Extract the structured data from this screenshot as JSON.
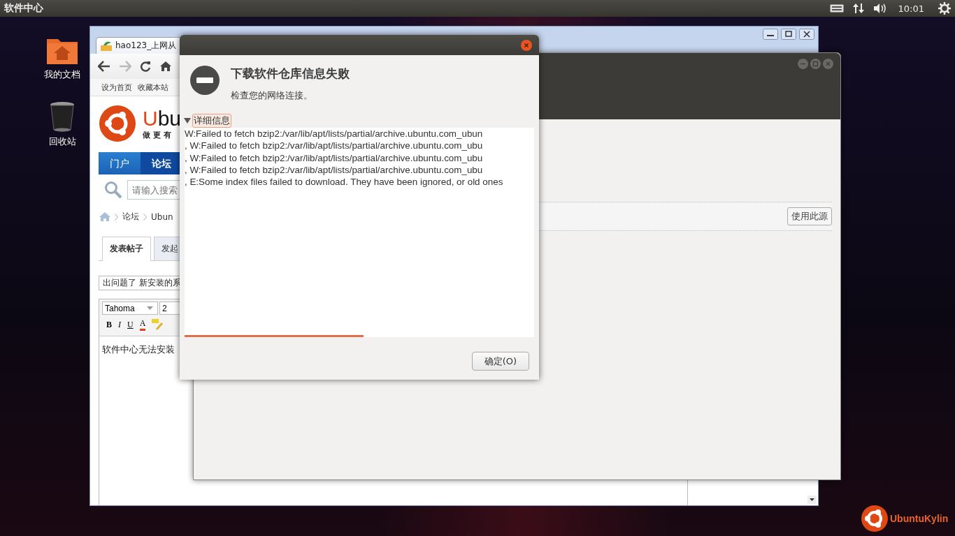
{
  "top_panel": {
    "app_name": "软件中心",
    "clock": "10:01"
  },
  "desktop_icons": [
    {
      "label": "我的文档",
      "kind": "folder"
    },
    {
      "label": "回收站",
      "kind": "trash"
    }
  ],
  "browser": {
    "tab_title": "hao123_上网从",
    "bookmarks": [
      "设为首页",
      "收藏本站"
    ],
    "logo_accent": "U",
    "logo_rest": "bu",
    "slogan": "做 更 有",
    "nav": [
      {
        "label": "门户",
        "selected": false
      },
      {
        "label": "论坛",
        "selected": true
      }
    ],
    "search_placeholder": "请输入搜索",
    "breadcrumb": [
      "论坛",
      "Ubun"
    ],
    "post_tabs": [
      {
        "label": "发表帖子",
        "selected": true
      },
      {
        "label": "发起",
        "selected": false
      }
    ],
    "subject": "出问题了 新安装的系",
    "font": "Tahoma",
    "font_size": "2",
    "format_buttons": [
      "B",
      "I",
      "U",
      "A"
    ],
    "body": "软件中心无法安装"
  },
  "software_center": {
    "use_source_button": "使用此源"
  },
  "dialog": {
    "title": "下载软件仓库信息失败",
    "message": "检查您的网络连接。",
    "details_label": "详细信息",
    "details_expanded": true,
    "details_lines": [
      "W:Failed to fetch bzip2:/var/lib/apt/lists/partial/archive.ubuntu.com_ubun",
      ", W:Failed to fetch bzip2:/var/lib/apt/lists/partial/archive.ubuntu.com_ubu",
      ", W:Failed to fetch bzip2:/var/lib/apt/lists/partial/archive.ubuntu.com_ubu",
      ", W:Failed to fetch bzip2:/var/lib/apt/lists/partial/archive.ubuntu.com_ubu",
      ", E:Some index files failed to download. They have been ignored, or old ones"
    ],
    "ok_button": "确定(O)"
  },
  "brand": "UbuntuKylin"
}
